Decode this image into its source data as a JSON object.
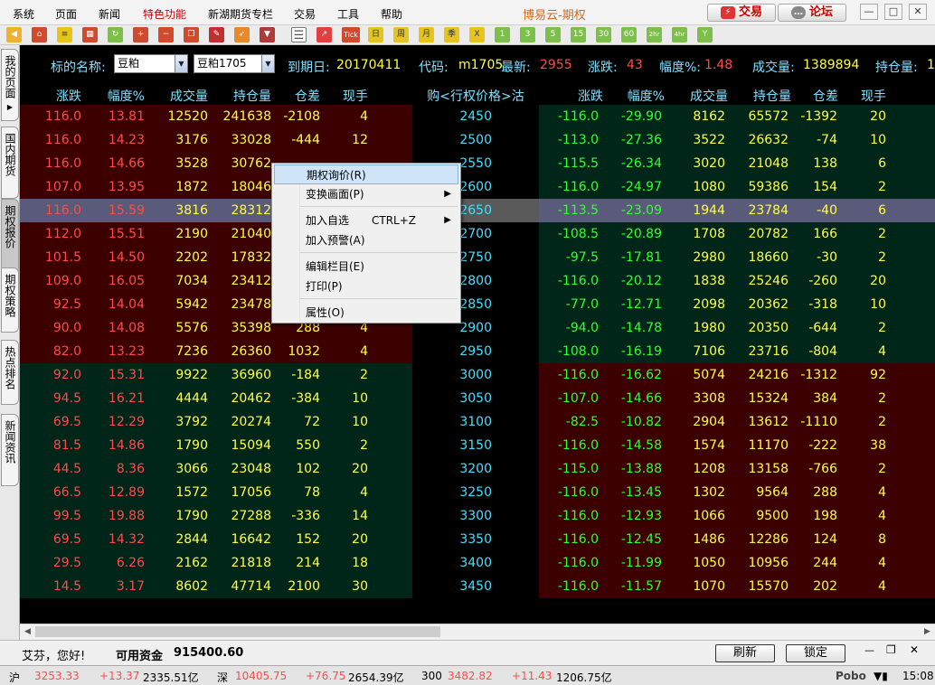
{
  "menubar": {
    "items": [
      "系统",
      "页面",
      "新闻",
      "特色功能",
      "新湖期货专栏",
      "交易",
      "工具",
      "帮助"
    ],
    "title": "博易云-期权",
    "trade_label": "交易",
    "forum_label": "论坛"
  },
  "toolbar": {
    "period_labels": [
      "1",
      "3",
      "5",
      "15",
      "30",
      "60",
      "2hr",
      "4hr",
      "Y"
    ],
    "cal_labels": [
      "日",
      "周",
      "月",
      "季",
      "X"
    ],
    "tick_label": "Tick"
  },
  "side_tabs": [
    "我的页面",
    "国内期货",
    "期权报价",
    "期权策略",
    "热点排名",
    "新闻资讯"
  ],
  "info": {
    "underlying_label": "标的名称:",
    "underlying_value": "豆粕",
    "contract_value": "豆粕1705",
    "expiry_label": "到期日:",
    "expiry_value": "20170411",
    "code_label": "代码:",
    "code_value": "m1705",
    "last_label": "最新:",
    "last_value": "2955",
    "change_label": "涨跌:",
    "change_value": "43",
    "pct_label": "幅度%:",
    "pct_value": "1.48",
    "volume_label": "成交量:",
    "volume_value": "1389894",
    "oi_label": "持仓量:",
    "oi_value": "1"
  },
  "headers": {
    "left": [
      "涨跌",
      "幅度%",
      "成交量",
      "持仓量",
      "仓差",
      "现手"
    ],
    "middle": "购<行权价格>沽",
    "right": [
      "涨跌",
      "幅度%",
      "成交量",
      "持仓量",
      "仓差",
      "现手"
    ]
  },
  "rows": [
    {
      "c": [
        "116.0",
        "13.81",
        "12520",
        "241638",
        "-2108",
        "4"
      ],
      "k": "2450",
      "p": [
        "-116.0",
        "-29.90",
        "8162",
        "65572",
        "-1392",
        "20"
      ]
    },
    {
      "c": [
        "116.0",
        "14.23",
        "3176",
        "33028",
        "-444",
        "12"
      ],
      "k": "2500",
      "p": [
        "-113.0",
        "-27.36",
        "3522",
        "26632",
        "-74",
        "10"
      ]
    },
    {
      "c": [
        "116.0",
        "14.66",
        "3528",
        "30762",
        "",
        ""
      ],
      "k": "2550",
      "p": [
        "-115.5",
        "-26.34",
        "3020",
        "21048",
        "138",
        "6"
      ]
    },
    {
      "c": [
        "107.0",
        "13.95",
        "1872",
        "18046",
        "",
        ""
      ],
      "k": "2600",
      "p": [
        "-116.0",
        "-24.97",
        "1080",
        "59386",
        "154",
        "2"
      ]
    },
    {
      "c": [
        "116.0",
        "15.59",
        "3816",
        "28312",
        "",
        ""
      ],
      "k": "2650",
      "p": [
        "-113.5",
        "-23.09",
        "1944",
        "23784",
        "-40",
        "6"
      ]
    },
    {
      "c": [
        "112.0",
        "15.51",
        "2190",
        "21040",
        "",
        ""
      ],
      "k": "2700",
      "p": [
        "-108.5",
        "-20.89",
        "1708",
        "20782",
        "166",
        "2"
      ]
    },
    {
      "c": [
        "101.5",
        "14.50",
        "2202",
        "17832",
        "",
        ""
      ],
      "k": "2750",
      "p": [
        "-97.5",
        "-17.81",
        "2980",
        "18660",
        "-30",
        "2"
      ]
    },
    {
      "c": [
        "109.0",
        "16.05",
        "7034",
        "23412",
        "",
        ""
      ],
      "k": "2800",
      "p": [
        "-116.0",
        "-20.12",
        "1838",
        "25246",
        "-260",
        "20"
      ]
    },
    {
      "c": [
        "92.5",
        "14.04",
        "5942",
        "23478",
        "",
        ""
      ],
      "k": "2850",
      "p": [
        "-77.0",
        "-12.71",
        "2098",
        "20362",
        "-318",
        "10"
      ]
    },
    {
      "c": [
        "90.0",
        "14.08",
        "5576",
        "35398",
        "288",
        "4"
      ],
      "k": "2900",
      "p": [
        "-94.0",
        "-14.78",
        "1980",
        "20350",
        "-644",
        "2"
      ]
    },
    {
      "c": [
        "82.0",
        "13.23",
        "7236",
        "26360",
        "1032",
        "4"
      ],
      "k": "2950",
      "p": [
        "-108.0",
        "-16.19",
        "7106",
        "23716",
        "-804",
        "4"
      ]
    },
    {
      "c": [
        "92.0",
        "15.31",
        "9922",
        "36960",
        "-184",
        "2"
      ],
      "k": "3000",
      "p": [
        "-116.0",
        "-16.62",
        "5074",
        "24216",
        "-1312",
        "92"
      ]
    },
    {
      "c": [
        "94.5",
        "16.21",
        "4444",
        "20462",
        "-384",
        "10"
      ],
      "k": "3050",
      "p": [
        "-107.0",
        "-14.66",
        "3308",
        "15324",
        "384",
        "2"
      ]
    },
    {
      "c": [
        "69.5",
        "12.29",
        "3792",
        "20274",
        "72",
        "10"
      ],
      "k": "3100",
      "p": [
        "-82.5",
        "-10.82",
        "2904",
        "13612",
        "-1110",
        "2"
      ]
    },
    {
      "c": [
        "81.5",
        "14.86",
        "1790",
        "15094",
        "550",
        "2"
      ],
      "k": "3150",
      "p": [
        "-116.0",
        "-14.58",
        "1574",
        "11170",
        "-222",
        "38"
      ]
    },
    {
      "c": [
        "44.5",
        "8.36",
        "3066",
        "23048",
        "102",
        "20"
      ],
      "k": "3200",
      "p": [
        "-115.0",
        "-13.88",
        "1208",
        "13158",
        "-766",
        "2"
      ]
    },
    {
      "c": [
        "66.5",
        "12.89",
        "1572",
        "17056",
        "78",
        "4"
      ],
      "k": "3250",
      "p": [
        "-116.0",
        "-13.45",
        "1302",
        "9564",
        "288",
        "4"
      ]
    },
    {
      "c": [
        "99.5",
        "19.88",
        "1790",
        "27288",
        "-336",
        "14"
      ],
      "k": "3300",
      "p": [
        "-116.0",
        "-12.93",
        "1066",
        "9500",
        "198",
        "4"
      ]
    },
    {
      "c": [
        "69.5",
        "14.32",
        "2844",
        "16642",
        "152",
        "20"
      ],
      "k": "3350",
      "p": [
        "-116.0",
        "-12.45",
        "1486",
        "12286",
        "124",
        "8"
      ]
    },
    {
      "c": [
        "29.5",
        "6.26",
        "2162",
        "21818",
        "214",
        "18"
      ],
      "k": "3400",
      "p": [
        "-116.0",
        "-11.99",
        "1050",
        "10956",
        "244",
        "4"
      ]
    },
    {
      "c": [
        "14.5",
        "3.17",
        "8602",
        "47714",
        "2100",
        "30"
      ],
      "k": "3450",
      "p": [
        "-116.0",
        "-11.57",
        "1070",
        "15570",
        "202",
        "4"
      ]
    }
  ],
  "context_menu": {
    "items": [
      {
        "label": "期权询价(R)",
        "shortcut": "",
        "submenu": false
      },
      {
        "label": "变换画面(P)",
        "shortcut": "",
        "submenu": true
      },
      {
        "label": "加入自选",
        "shortcut": "CTRL+Z",
        "submenu": true
      },
      {
        "label": "加入预警(A)",
        "shortcut": "",
        "submenu": false
      },
      {
        "label": "编辑栏目(E)",
        "shortcut": "",
        "submenu": false
      },
      {
        "label": "打印(P)",
        "shortcut": "",
        "submenu": false
      },
      {
        "label": "属性(O)",
        "shortcut": "",
        "submenu": false
      }
    ]
  },
  "bottom": {
    "greeting": "艾芬，您好!",
    "funds_label": "可用资金",
    "funds_value": "915400.60",
    "refresh_label": "刷新",
    "lock_label": "锁定"
  },
  "status": {
    "sh_label": "沪",
    "sh_index": "3253.33",
    "sh_change": "+13.37",
    "sh_amount": "2335.51亿",
    "sz_label": "深",
    "sz_index": "10405.75",
    "sz_change": "+76.75",
    "sz_amount": "2654.39亿",
    "c300_label": "300",
    "c300_index": "3482.82",
    "c300_change": "+11.43",
    "c300_amount": "1206.75亿",
    "brand": "Pobo",
    "time": "15:08"
  }
}
